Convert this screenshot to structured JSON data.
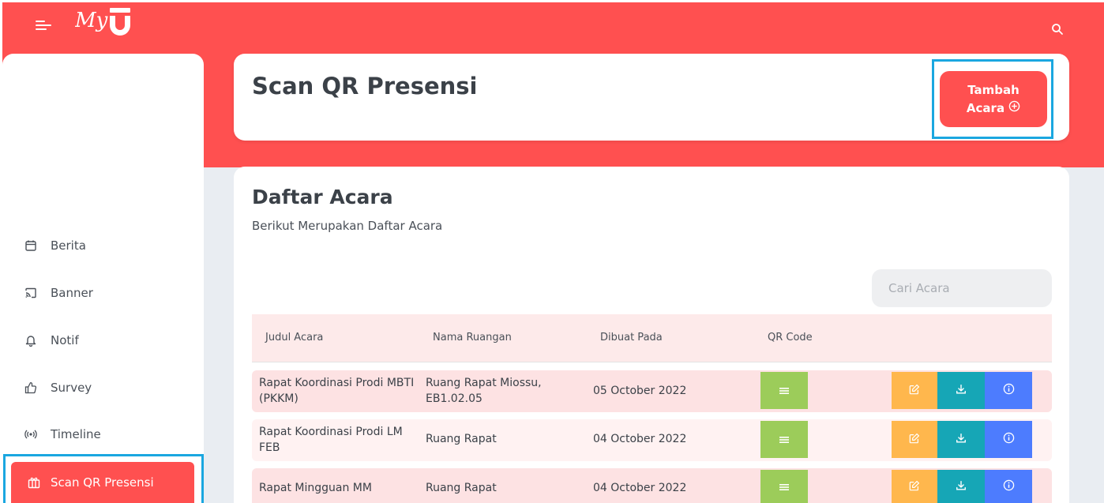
{
  "app": {
    "logo_text": "My"
  },
  "sidebar": {
    "items": [
      {
        "label": "Berita",
        "icon": "calendar-icon"
      },
      {
        "label": "Banner",
        "icon": "cast-icon"
      },
      {
        "label": "Notif",
        "icon": "bell-icon"
      },
      {
        "label": "Survey",
        "icon": "thumbs-up-icon"
      },
      {
        "label": "Timeline",
        "icon": "broadcast-icon"
      },
      {
        "label": "Scan QR Presensi",
        "icon": "gift-icon",
        "active": true
      }
    ]
  },
  "header": {
    "title": "Scan QR Presensi",
    "add_button": {
      "line1": "Tambah",
      "line2": "Acara"
    }
  },
  "main": {
    "title": "Daftar Acara",
    "subtitle": "Berikut Merupakan Daftar Acara",
    "search": {
      "placeholder": "Cari Acara",
      "value": ""
    },
    "columns": [
      "Judul Acara",
      "Nama Ruangan",
      "Dibuat Pada",
      "QR Code"
    ],
    "rows": [
      {
        "judul": "Rapat Koordinasi Prodi MBTI (PKKM)",
        "ruangan": "Ruang Rapat Miossu, EB1.02.05",
        "dibuat": "05 October 2022"
      },
      {
        "judul": "Rapat Koordinasi Prodi LM FEB",
        "ruangan": "Ruang Rapat",
        "dibuat": "04 October 2022"
      },
      {
        "judul": "Rapat Mingguan MM",
        "ruangan": "Ruang Rapat",
        "dibuat": "04 October 2022"
      }
    ]
  },
  "colors": {
    "brand_red": "#ff5050",
    "highlight_blue": "#1aa7e0",
    "qr_green": "#9ccc5a",
    "edit_orange": "#ffb74d",
    "download_teal": "#16a6b6",
    "info_blue": "#4d7cfe"
  }
}
